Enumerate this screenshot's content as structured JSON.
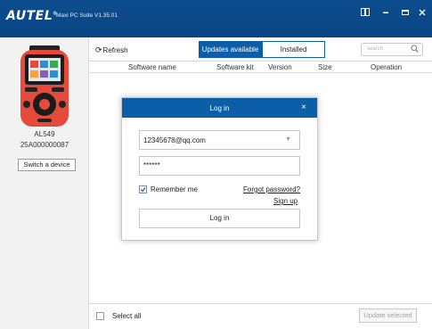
{
  "titlebar": {
    "brand": "AUTEL",
    "brand_mark": "®",
    "app_title": "Maxi PC Suite V1.35.01"
  },
  "sidebar": {
    "device_name": "AL549",
    "serial": "25A000000087",
    "switch_label": "Switch a device"
  },
  "toolbar": {
    "refresh_label": "Refresh",
    "tabs": [
      {
        "label": "Updates available",
        "active": true
      },
      {
        "label": "Installed",
        "active": false
      }
    ],
    "search_placeholder": "search"
  },
  "table": {
    "columns": [
      "Software name",
      "Software kit",
      "Version",
      "Size",
      "Operation"
    ]
  },
  "footer": {
    "select_all_label": "Select all",
    "update_selected_label": "Update selected"
  },
  "dialog": {
    "title": "Log in",
    "close_icon": "×",
    "email_value": "12345678@qq.com",
    "password_value": "******",
    "remember_label": "Remember me",
    "remember_checked": true,
    "forgot_label": "Forgot password?",
    "signup_label": "Sign up",
    "login_button_label": "Log in"
  },
  "colors": {
    "titlebar": "#0c4d8f",
    "accent": "#0c5ea8",
    "device_body": "#e64a3b"
  }
}
